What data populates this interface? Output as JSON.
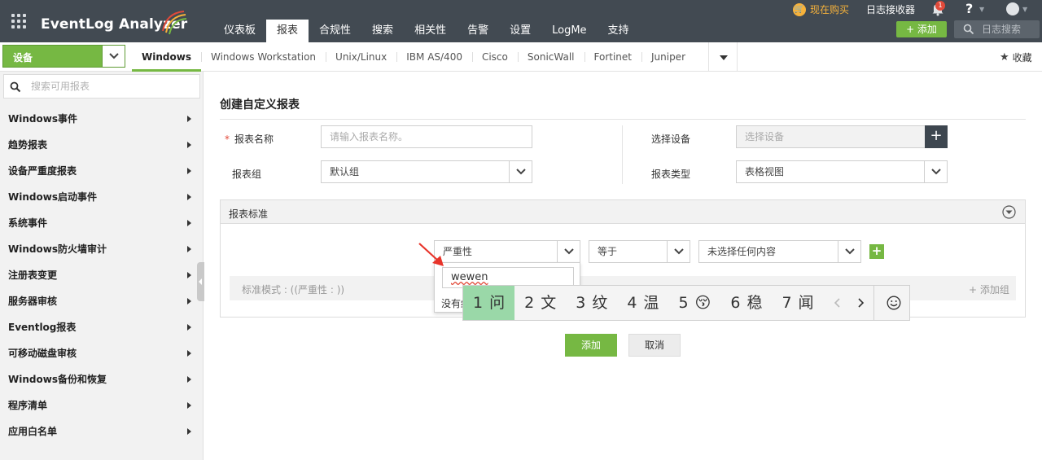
{
  "header": {
    "brand": "EventLog Analyzer",
    "nav": [
      "仪表板",
      "报表",
      "合规性",
      "搜索",
      "相关性",
      "告警",
      "设置",
      "LogMe",
      "支持"
    ],
    "active_nav": "报表",
    "buy_now": "现在购买",
    "log_collector": "日志接收器",
    "notification_count": "1",
    "help": "?",
    "add_label": "+ 添加",
    "log_search_placeholder": "日志搜索"
  },
  "subbar": {
    "device_selector": "设备",
    "device_tabs": [
      "Windows",
      "Windows Workstation",
      "Unix/Linux",
      "IBM AS/400",
      "Cisco",
      "SonicWall",
      "Fortinet",
      "Juniper"
    ],
    "active_tab": "Windows",
    "favorites": "收藏"
  },
  "sidebar": {
    "search_placeholder": "搜索可用报表",
    "items": [
      "Windows事件",
      "趋势报表",
      "设备严重度报表",
      "Windows启动事件",
      "系统事件",
      "Windows防火墙审计",
      "注册表变更",
      "服务器审核",
      "Eventlog报表",
      "可移动磁盘审核",
      "Windows备份和恢复",
      "程序清单",
      "应用白名单"
    ]
  },
  "form": {
    "title": "创建自定义报表",
    "required_mark": "*",
    "report_name_label": "报表名称",
    "report_name_placeholder": "请输入报表名称。",
    "select_device_label": "选择设备",
    "select_device_placeholder": "选择设备",
    "report_group_label": "报表组",
    "report_group_value": "默认组",
    "report_type_label": "报表类型",
    "report_type_value": "表格视图"
  },
  "criteria": {
    "header": "报表标准",
    "field_value": "严重性",
    "operator_value": "等于",
    "value_value": "未选择任何内容",
    "pattern_text": "标准模式 : ((严重性 : ))",
    "add_group": "+ 添加组"
  },
  "dropdown": {
    "search_text": "wewen",
    "no_results": "没有结果匹配"
  },
  "ime": {
    "candidates": [
      {
        "num": "1",
        "text": "问"
      },
      {
        "num": "2",
        "text": "文"
      },
      {
        "num": "3",
        "text": "纹"
      },
      {
        "num": "4",
        "text": "温"
      },
      {
        "num": "5",
        "text": "😚"
      },
      {
        "num": "6",
        "text": "稳"
      },
      {
        "num": "7",
        "text": "闻"
      }
    ],
    "highlight_index": 0
  },
  "buttons": {
    "add": "添加",
    "cancel": "取消"
  },
  "colors": {
    "header_bg": "#424a52",
    "accent_green": "#76b843",
    "buy_gold": "#f6b23b",
    "ime_highlight": "#9ad8a8"
  }
}
